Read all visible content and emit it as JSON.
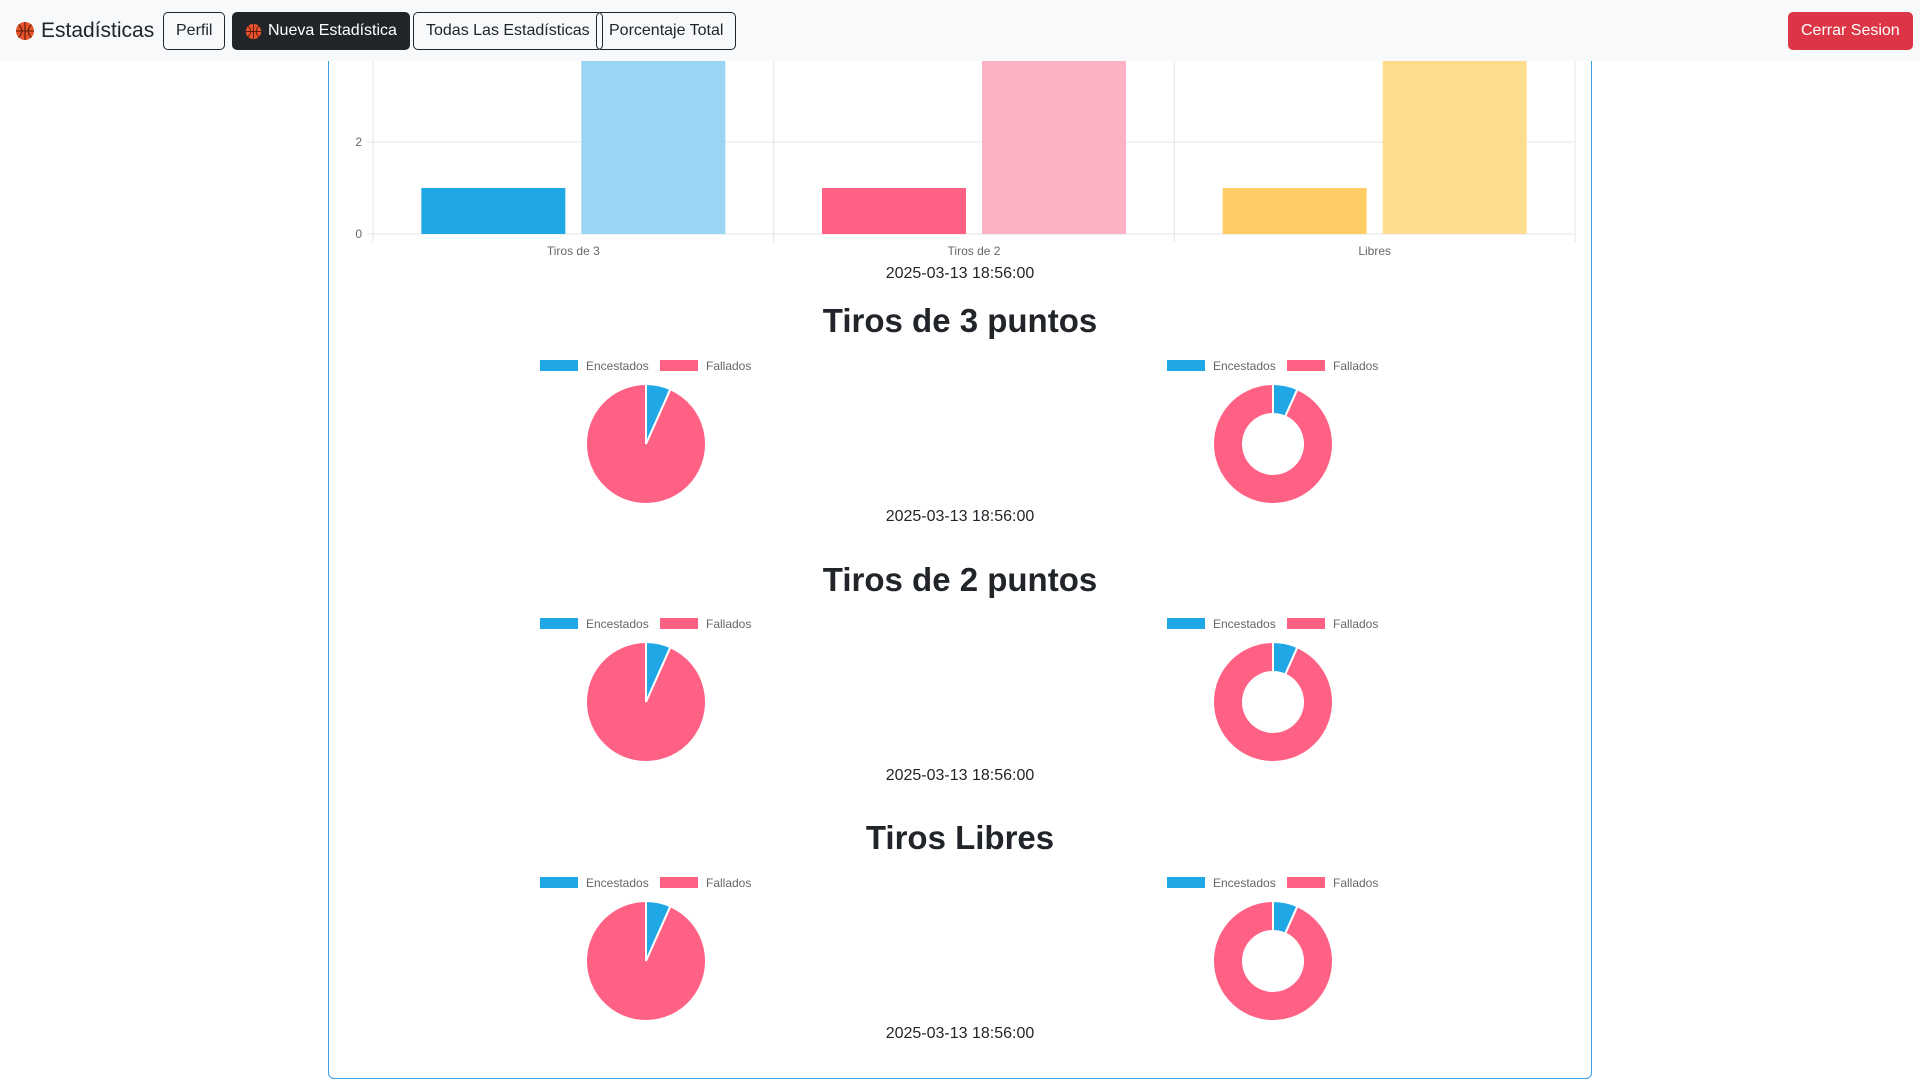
{
  "navbar": {
    "brand": "Estadísticas",
    "buttons": {
      "perfil": "Perfil",
      "nueva": "Nueva Estadística",
      "todas": "Todas Las Estadísticas",
      "porcentaje": "Porcentaje Total",
      "logout": "Cerrar Sesion"
    }
  },
  "colors": {
    "blue": "#1fa7e6",
    "blue_light": "#9ad5f3",
    "pink": "#ff6185",
    "pink_light": "#ffb1c4",
    "yellow": "#ffcc66",
    "yellow_light": "#ffdc8e",
    "danger": "#dc3545",
    "card_border": "#3ea0e4"
  },
  "bar_section": {
    "date": "2025-03-13 18:56:00"
  },
  "sections": [
    {
      "title": "Tiros de 3 puntos",
      "date": "2025-03-13 18:56:00"
    },
    {
      "title": "Tiros de 2 puntos",
      "date": "2025-03-13 18:56:00"
    },
    {
      "title": "Tiros Libres",
      "date": "2025-03-13 18:56:00"
    }
  ],
  "chart_data": [
    {
      "type": "bar",
      "categories": [
        "Tiros de 3",
        "Tiros de 2",
        "Libres"
      ],
      "series": [
        {
          "values": [
            1,
            1,
            1
          ]
        },
        {
          "values": [
            4,
            4,
            4
          ]
        }
      ],
      "y_ticks": [
        "0",
        "2"
      ],
      "ylim": [
        0,
        3.8
      ],
      "grid": true,
      "note_visible_top_cut": true
    },
    {
      "type": "pie",
      "labels": [
        "Encestados",
        "Fallados"
      ],
      "values": [
        1,
        14
      ],
      "legend": "top",
      "variants": [
        "pie",
        "doughnut"
      ]
    },
    {
      "type": "pie",
      "labels": [
        "Encestados",
        "Fallados"
      ],
      "values": [
        1,
        14
      ],
      "legend": "top",
      "variants": [
        "pie",
        "doughnut"
      ]
    },
    {
      "type": "pie",
      "labels": [
        "Encestados",
        "Fallados"
      ],
      "values": [
        1,
        14
      ],
      "legend": "top",
      "variants": [
        "pie",
        "doughnut"
      ]
    }
  ]
}
